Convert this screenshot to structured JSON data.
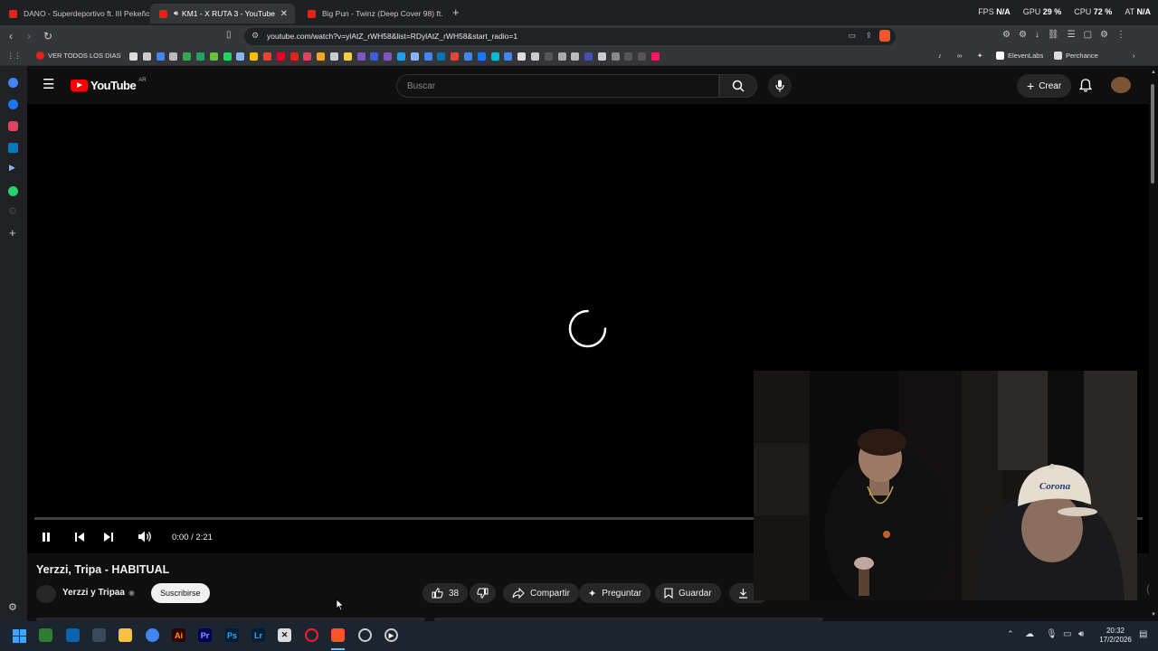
{
  "browser": {
    "tabs": [
      {
        "title": "DANO - Superdeportivo ft. III Pekeño"
      },
      {
        "title": "KM1 - X RUTA 3 - YouTube",
        "active": true
      },
      {
        "title": "Big Pun - Twinz (Deep Cover 98) ft. F"
      }
    ],
    "url": "youtube.com/watch?v=ylAtZ_rWH58&list=RDylAtZ_rWH58&start_radio=1",
    "stats": [
      {
        "label": "FPS",
        "value": "N/A"
      },
      {
        "label": "GPU",
        "value": "29 %"
      },
      {
        "label": "CPU",
        "value": "72 %"
      },
      {
        "label": "AT",
        "value": "N/A"
      }
    ],
    "bookmarks": [
      {
        "label": "VER TODOS LOS DIAS"
      },
      {
        "label": "ElevenLabs"
      },
      {
        "label": "Perchance"
      }
    ]
  },
  "youtube": {
    "logo_text": "YouTube",
    "region": "AR",
    "search_placeholder": "Buscar",
    "create_label": "Crear"
  },
  "player": {
    "time": "0:00 / 2:21"
  },
  "video": {
    "title": "Yerzzi, Tripa - HABITUAL",
    "channel": "Yerzzi y Tripaa",
    "subscribe_label": "Suscribirse",
    "likes": "38",
    "share_label": "Compartir",
    "ask_label": "Preguntar",
    "save_label": "Guardar",
    "download_label": "D"
  },
  "taskbar": {
    "time": "20:32",
    "date": "17/2/2026"
  },
  "colors": {
    "youtube_red": "#ff0000",
    "chip_bg": "#272727",
    "taskbar_bg": "#1b2530"
  }
}
